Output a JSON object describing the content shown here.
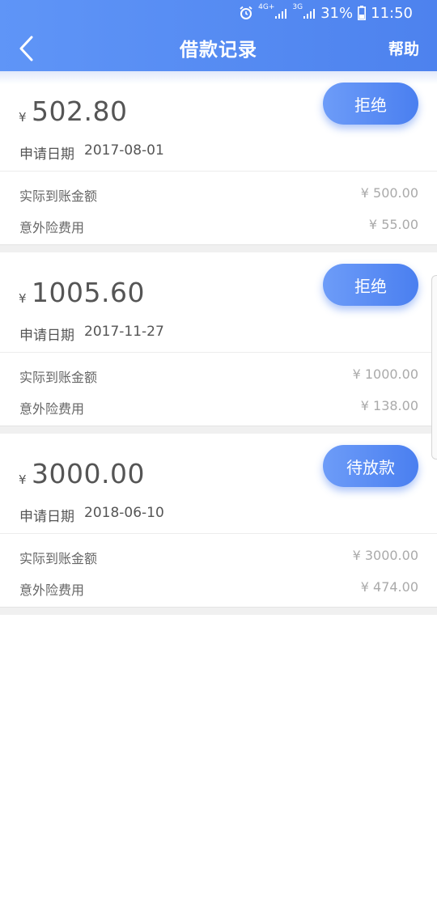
{
  "status_bar": {
    "signal_tag_top": "4G+",
    "signal_tag_second": "3G",
    "battery_percent": "31%",
    "time": "11:50",
    "icons": [
      "alarm-icon",
      "signal-4g-icon",
      "signal-3g-icon",
      "battery-icon"
    ]
  },
  "nav": {
    "title": "借款记录",
    "help_label": "帮助",
    "back_icon": "chevron-left-icon"
  },
  "labels": {
    "currency": "¥",
    "apply_date_label": "申请日期",
    "actual_amount_label": "实际到账金额",
    "insurance_label": "意外险费用"
  },
  "records": [
    {
      "amount": "502.80",
      "apply_date": "2017-08-01",
      "status": "拒绝",
      "actual_amount": "¥ 500.00",
      "insurance_fee": "¥ 55.00"
    },
    {
      "amount": "1005.60",
      "apply_date": "2017-11-27",
      "status": "拒绝",
      "actual_amount": "¥ 1000.00",
      "insurance_fee": "¥ 138.00"
    },
    {
      "amount": "3000.00",
      "apply_date": "2018-06-10",
      "status": "待放款",
      "actual_amount": "¥ 3000.00",
      "insurance_fee": "¥ 474.00"
    }
  ],
  "colors": {
    "header_start": "#5f95f7",
    "header_end": "#4d82ee",
    "button_start": "#6d9cf8",
    "button_end": "#4a7ff0",
    "primary_text": "#555555",
    "secondary_text": "#aaaaaa"
  }
}
